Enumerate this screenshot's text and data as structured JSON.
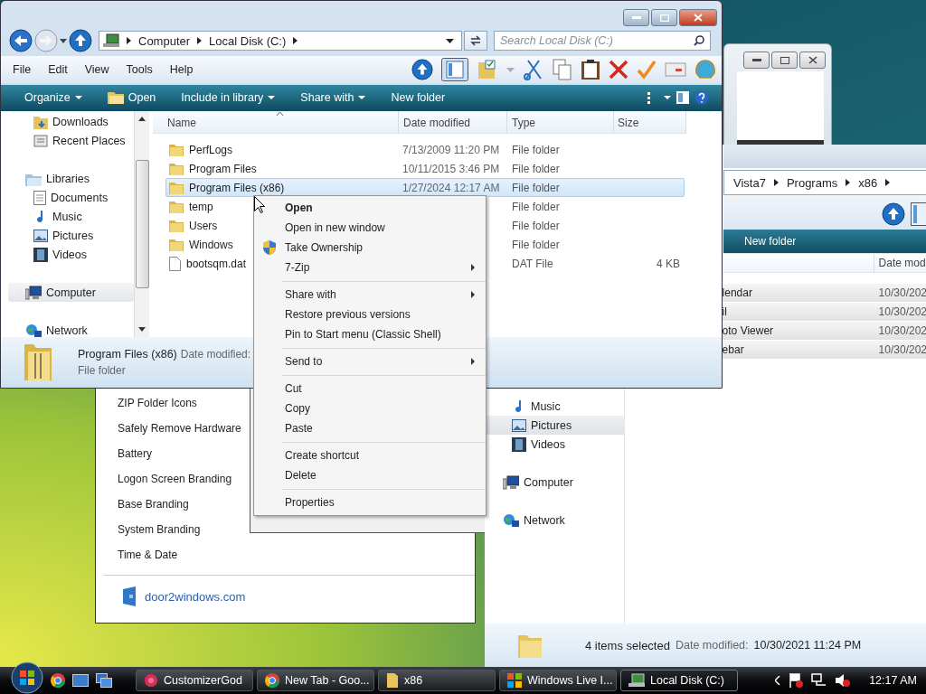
{
  "main_window": {
    "address": [
      "Computer",
      "Local Disk (C:)"
    ],
    "search": {
      "placeholder": "Search Local Disk (C:)"
    },
    "menu_bar": [
      "File",
      "Edit",
      "View",
      "Tools",
      "Help"
    ],
    "command_bar": [
      {
        "label": "Organize",
        "dropdown": true,
        "has_icon": false
      },
      {
        "label": "Open",
        "dropdown": false,
        "has_icon": true
      },
      {
        "label": "Include in library",
        "dropdown": true,
        "has_icon": false
      },
      {
        "label": "Share with",
        "dropdown": true,
        "has_icon": false
      },
      {
        "label": "New folder",
        "dropdown": false,
        "has_icon": false
      }
    ],
    "nav": [
      {
        "children": [
          {
            "label": "Downloads",
            "kind": "downloads",
            "selected": false
          },
          {
            "label": "Recent Places",
            "kind": "recent",
            "selected": false
          }
        ]
      },
      {
        "label": "Libraries",
        "kind": "library",
        "selected": false,
        "children": [
          {
            "label": "Documents",
            "kind": "documents",
            "selected": false
          },
          {
            "label": "Music",
            "kind": "music",
            "selected": false
          },
          {
            "label": "Pictures",
            "kind": "pictures",
            "selected": false
          },
          {
            "label": "Videos",
            "kind": "videos",
            "selected": false
          }
        ]
      },
      {
        "label": "Computer",
        "kind": "computer",
        "selected": true
      },
      {
        "label": "Network",
        "kind": "network",
        "selected": false
      }
    ],
    "columns": [
      "Name",
      "Date modified",
      "Type",
      "Size"
    ],
    "rows": [
      {
        "name": "PerfLogs",
        "date": "7/13/2009 11:20 PM",
        "type": "File folder",
        "kind": "folder",
        "selected": false
      },
      {
        "name": "Program Files",
        "date": "10/11/2015 3:46 PM",
        "type": "File folder",
        "kind": "folder",
        "selected": false
      },
      {
        "name": "Program Files (x86)",
        "date": "1/27/2024 12:17 AM",
        "type": "File folder",
        "kind": "folder",
        "selected": true
      },
      {
        "name": "temp",
        "type": "File folder",
        "kind": "folder",
        "selected": false
      },
      {
        "name": "Users",
        "type": "File folder",
        "kind": "folder",
        "selected": false
      },
      {
        "name": "Windows",
        "type": "File folder",
        "kind": "folder",
        "selected": false
      },
      {
        "name": "bootsqm.dat",
        "type": "DAT File",
        "size": "4 KB",
        "kind": "file",
        "selected": false
      }
    ],
    "details": {
      "name": "Program Files (x86)",
      "date_label": "Date modified:",
      "type": "File folder"
    }
  },
  "context_menu": {
    "items": [
      {
        "kind": "item",
        "label": "Open",
        "default": true,
        "submenu": false,
        "has_icon": false
      },
      {
        "kind": "item",
        "label": "Open in new window",
        "default": false,
        "submenu": false,
        "has_icon": false
      },
      {
        "kind": "item",
        "label": "Take Ownership",
        "default": false,
        "submenu": false,
        "has_icon": true
      },
      {
        "kind": "item",
        "label": "7-Zip",
        "default": false,
        "submenu": true,
        "has_icon": false
      },
      {
        "kind": "separator"
      },
      {
        "kind": "item",
        "label": "Share with",
        "default": false,
        "submenu": true,
        "has_icon": false
      },
      {
        "kind": "item",
        "label": "Restore previous versions",
        "default": false,
        "submenu": false,
        "has_icon": false
      },
      {
        "kind": "item",
        "label": "Pin to Start menu (Classic Shell)",
        "default": false,
        "submenu": false,
        "has_icon": false
      },
      {
        "kind": "separator"
      },
      {
        "kind": "item",
        "label": "Send to",
        "default": false,
        "submenu": true,
        "has_icon": false
      },
      {
        "kind": "separator"
      },
      {
        "kind": "item",
        "label": "Cut",
        "default": false,
        "submenu": false,
        "has_icon": false
      },
      {
        "kind": "item",
        "label": "Copy",
        "default": false,
        "submenu": false,
        "has_icon": false
      },
      {
        "kind": "item",
        "label": "Paste",
        "default": false,
        "submenu": false,
        "has_icon": false
      },
      {
        "kind": "separator"
      },
      {
        "kind": "item",
        "label": "Create shortcut",
        "default": false,
        "submenu": false,
        "has_icon": false
      },
      {
        "kind": "item",
        "label": "Delete",
        "default": false,
        "submenu": false,
        "has_icon": false
      },
      {
        "kind": "separator"
      },
      {
        "kind": "item",
        "label": "Properties",
        "default": false,
        "submenu": false,
        "has_icon": false
      }
    ]
  },
  "right_window": {
    "address": [
      "Vista7",
      "Programs",
      "x86"
    ],
    "command": "New folder",
    "column": "Date mod",
    "rows": [
      {
        "name": "lendar",
        "date": "10/30/202",
        "selected": true
      },
      {
        "name": "il",
        "date": "10/30/202",
        "selected": true
      },
      {
        "name": "oto Viewer",
        "date": "10/30/202",
        "selected": true
      },
      {
        "name": "ebar",
        "date": "10/30/202",
        "selected": true
      }
    ],
    "nav": [
      {
        "label": "Music",
        "kind": "music",
        "selected": false
      },
      {
        "label": "Pictures",
        "kind": "pictures",
        "selected": true
      },
      {
        "label": "Videos",
        "kind": "videos",
        "selected": false
      },
      {
        "label": "Computer",
        "kind": "computer",
        "selected": false
      },
      {
        "label": "Network",
        "kind": "network",
        "selected": false
      }
    ],
    "status": {
      "count": "4 items selected",
      "date_label": "Date modified:",
      "date": "10/30/2021 11:24 PM"
    }
  },
  "customizer_window": {
    "items": [
      "ZIP Folder Icons",
      "Safely Remove Hardware",
      "Battery",
      "Logon Screen Branding",
      "Base Branding",
      "System Branding",
      "Time & Date"
    ],
    "link": "door2windows.com"
  },
  "taskbar": {
    "tasks": [
      {
        "label": "CustomizerGod",
        "kind": "customizer",
        "selected": false
      },
      {
        "label": "New Tab - Goo...",
        "kind": "browser",
        "selected": false
      },
      {
        "label": "x86",
        "kind": "folder",
        "selected": false
      },
      {
        "label": "Windows Live I...",
        "kind": "windows",
        "selected": false
      },
      {
        "label": "Local Disk (C:)",
        "kind": "explorer",
        "selected": true
      }
    ],
    "clock": "12:17 AM"
  }
}
